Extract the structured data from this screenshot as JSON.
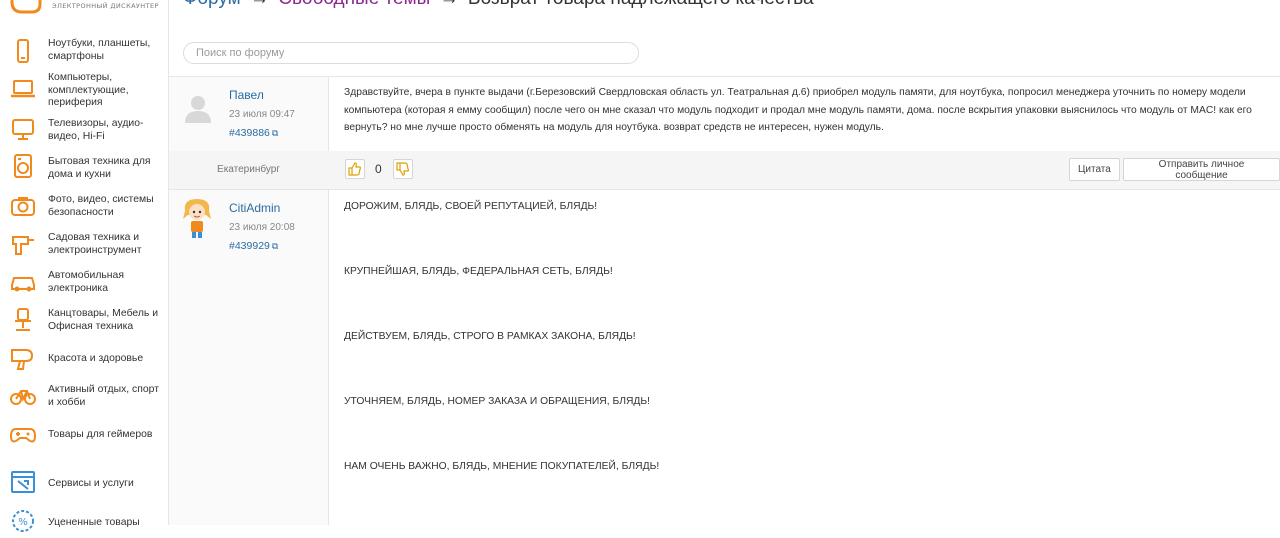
{
  "sidebar": {
    "logo_subtitle": "электронный дискаунтер",
    "items": [
      {
        "label": "Ноутбуки, планшеты, смартфоны",
        "icon": "phone-icon"
      },
      {
        "label": "Компьютеры, комплектующие, периферия",
        "icon": "laptop-icon"
      },
      {
        "label": "Телевизоры, аудио-видео, Hi-Fi",
        "icon": "tv-icon"
      },
      {
        "label": "Бытовая техника для дома и кухни",
        "icon": "washing-machine-icon"
      },
      {
        "label": "Фото, видео, системы безопасности",
        "icon": "camera-icon"
      },
      {
        "label": "Садовая техника и электроинструмент",
        "icon": "drill-icon"
      },
      {
        "label": "Автомобильная электроника",
        "icon": "car-icon"
      },
      {
        "label": "Канцтовары, Мебель и Офисная техника",
        "icon": "office-chair-icon"
      },
      {
        "label": "Красота и здоровье",
        "icon": "hair-dryer-icon"
      },
      {
        "label": "Активный отдых, спорт и хобби",
        "icon": "bicycle-icon"
      },
      {
        "label": "Товары для геймеров",
        "icon": "gamepad-icon"
      },
      {
        "label": "Сервисы и услуги",
        "icon": "services-icon"
      },
      {
        "label": "Уцененные товары",
        "icon": "discount-icon"
      }
    ]
  },
  "breadcrumb": {
    "forum": "Форум",
    "arrow": "→",
    "topic": "Свободные темы",
    "current": "Возврат товара надлежащего качества"
  },
  "search": {
    "placeholder": "Поиск по форуму"
  },
  "posts": [
    {
      "author": "Павел",
      "date": "23 июля 09:47",
      "id": "#439886",
      "city": "Екатеринбург",
      "text": "Здравствуйте, вчера в пункте выдачи (г.Березовский Свердловская область ул. Театральная д.6) приобрел модуль памяти, для ноутбука, попросил менеджера уточнить по номеру модели компьютера (которая я емму сообщил) после чего он мне сказал что модуль подходит и продал мне модуль памяти, дома. после вскрытия упаковки выяснилось что модуль от MAC! как его вернуть? но мне лучше просто обменять на модуль для ноутбука. возврат средств не интересен, нужен модуль.",
      "votes": "0",
      "quote_label": "Цитата",
      "message_label": "Отправить личное сообщение"
    },
    {
      "author": "CitiAdmin",
      "date": "23 июля 20:08",
      "id": "#439929",
      "lines": [
        "ДОРОЖИМ, БЛЯДЬ, СВОЕЙ РЕПУТАЦИЕЙ, БЛЯДЬ!",
        "КРУПНЕЙШАЯ, БЛЯДЬ, ФЕДЕРАЛЬНАЯ СЕТЬ, БЛЯДЬ!",
        "ДЕЙСТВУЕМ, БЛЯДЬ, СТРОГО В РАМКАХ ЗАКОНА, БЛЯДЬ!",
        "УТОЧНЯЕМ, БЛЯДЬ, НОМЕР ЗАКАЗА И ОБРАЩЕНИЯ, БЛЯДЬ!",
        "НАМ ОЧЕНЬ ВАЖНО, БЛЯДЬ, МНЕНИЕ ПОКУПАТЕЛЕЙ, БЛЯДЬ!"
      ]
    }
  ],
  "colors": {
    "accent_orange": "#f08a1c",
    "link_blue": "#2a6ca3",
    "topic_purple": "#8b2a8e"
  }
}
